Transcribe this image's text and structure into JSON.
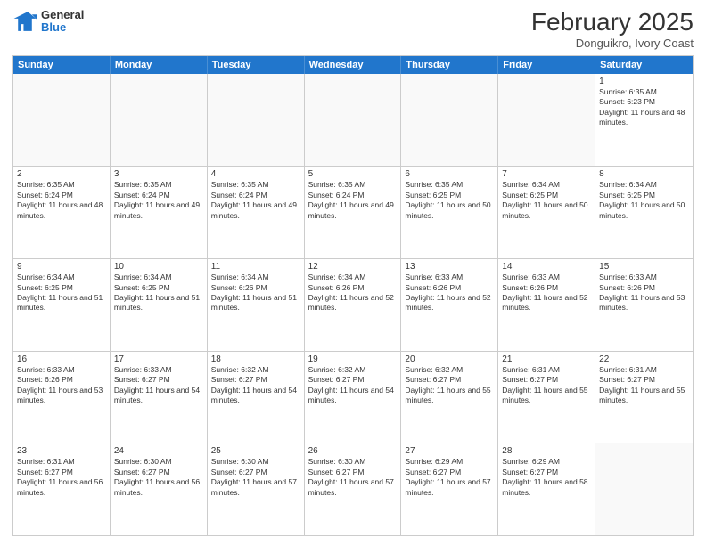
{
  "header": {
    "logo": {
      "general": "General",
      "blue": "Blue"
    },
    "title": "February 2025",
    "subtitle": "Donguikro, Ivory Coast"
  },
  "weekdays": [
    "Sunday",
    "Monday",
    "Tuesday",
    "Wednesday",
    "Thursday",
    "Friday",
    "Saturday"
  ],
  "weeks": [
    [
      {
        "day": "",
        "info": ""
      },
      {
        "day": "",
        "info": ""
      },
      {
        "day": "",
        "info": ""
      },
      {
        "day": "",
        "info": ""
      },
      {
        "day": "",
        "info": ""
      },
      {
        "day": "",
        "info": ""
      },
      {
        "day": "1",
        "info": "Sunrise: 6:35 AM\nSunset: 6:23 PM\nDaylight: 11 hours and 48 minutes."
      }
    ],
    [
      {
        "day": "2",
        "info": "Sunrise: 6:35 AM\nSunset: 6:24 PM\nDaylight: 11 hours and 48 minutes."
      },
      {
        "day": "3",
        "info": "Sunrise: 6:35 AM\nSunset: 6:24 PM\nDaylight: 11 hours and 49 minutes."
      },
      {
        "day": "4",
        "info": "Sunrise: 6:35 AM\nSunset: 6:24 PM\nDaylight: 11 hours and 49 minutes."
      },
      {
        "day": "5",
        "info": "Sunrise: 6:35 AM\nSunset: 6:24 PM\nDaylight: 11 hours and 49 minutes."
      },
      {
        "day": "6",
        "info": "Sunrise: 6:35 AM\nSunset: 6:25 PM\nDaylight: 11 hours and 50 minutes."
      },
      {
        "day": "7",
        "info": "Sunrise: 6:34 AM\nSunset: 6:25 PM\nDaylight: 11 hours and 50 minutes."
      },
      {
        "day": "8",
        "info": "Sunrise: 6:34 AM\nSunset: 6:25 PM\nDaylight: 11 hours and 50 minutes."
      }
    ],
    [
      {
        "day": "9",
        "info": "Sunrise: 6:34 AM\nSunset: 6:25 PM\nDaylight: 11 hours and 51 minutes."
      },
      {
        "day": "10",
        "info": "Sunrise: 6:34 AM\nSunset: 6:25 PM\nDaylight: 11 hours and 51 minutes."
      },
      {
        "day": "11",
        "info": "Sunrise: 6:34 AM\nSunset: 6:26 PM\nDaylight: 11 hours and 51 minutes."
      },
      {
        "day": "12",
        "info": "Sunrise: 6:34 AM\nSunset: 6:26 PM\nDaylight: 11 hours and 52 minutes."
      },
      {
        "day": "13",
        "info": "Sunrise: 6:33 AM\nSunset: 6:26 PM\nDaylight: 11 hours and 52 minutes."
      },
      {
        "day": "14",
        "info": "Sunrise: 6:33 AM\nSunset: 6:26 PM\nDaylight: 11 hours and 52 minutes."
      },
      {
        "day": "15",
        "info": "Sunrise: 6:33 AM\nSunset: 6:26 PM\nDaylight: 11 hours and 53 minutes."
      }
    ],
    [
      {
        "day": "16",
        "info": "Sunrise: 6:33 AM\nSunset: 6:26 PM\nDaylight: 11 hours and 53 minutes."
      },
      {
        "day": "17",
        "info": "Sunrise: 6:33 AM\nSunset: 6:27 PM\nDaylight: 11 hours and 54 minutes."
      },
      {
        "day": "18",
        "info": "Sunrise: 6:32 AM\nSunset: 6:27 PM\nDaylight: 11 hours and 54 minutes."
      },
      {
        "day": "19",
        "info": "Sunrise: 6:32 AM\nSunset: 6:27 PM\nDaylight: 11 hours and 54 minutes."
      },
      {
        "day": "20",
        "info": "Sunrise: 6:32 AM\nSunset: 6:27 PM\nDaylight: 11 hours and 55 minutes."
      },
      {
        "day": "21",
        "info": "Sunrise: 6:31 AM\nSunset: 6:27 PM\nDaylight: 11 hours and 55 minutes."
      },
      {
        "day": "22",
        "info": "Sunrise: 6:31 AM\nSunset: 6:27 PM\nDaylight: 11 hours and 55 minutes."
      }
    ],
    [
      {
        "day": "23",
        "info": "Sunrise: 6:31 AM\nSunset: 6:27 PM\nDaylight: 11 hours and 56 minutes."
      },
      {
        "day": "24",
        "info": "Sunrise: 6:30 AM\nSunset: 6:27 PM\nDaylight: 11 hours and 56 minutes."
      },
      {
        "day": "25",
        "info": "Sunrise: 6:30 AM\nSunset: 6:27 PM\nDaylight: 11 hours and 57 minutes."
      },
      {
        "day": "26",
        "info": "Sunrise: 6:30 AM\nSunset: 6:27 PM\nDaylight: 11 hours and 57 minutes."
      },
      {
        "day": "27",
        "info": "Sunrise: 6:29 AM\nSunset: 6:27 PM\nDaylight: 11 hours and 57 minutes."
      },
      {
        "day": "28",
        "info": "Sunrise: 6:29 AM\nSunset: 6:27 PM\nDaylight: 11 hours and 58 minutes."
      },
      {
        "day": "",
        "info": ""
      }
    ]
  ]
}
